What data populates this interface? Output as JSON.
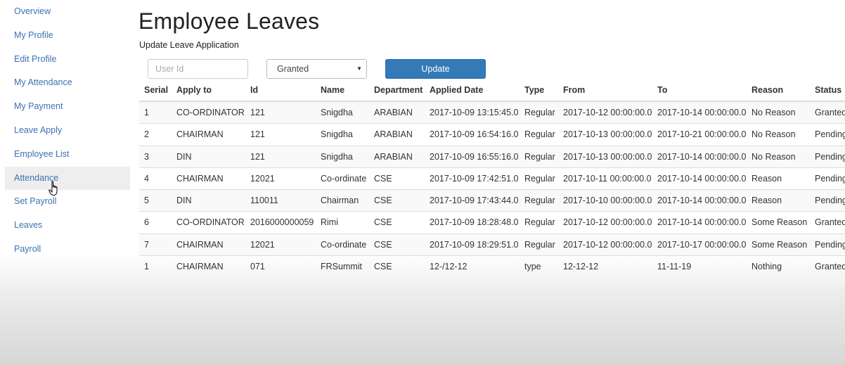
{
  "sidebar": {
    "items": [
      {
        "label": "Overview"
      },
      {
        "label": "My Profile"
      },
      {
        "label": "Edit Profile"
      },
      {
        "label": "My Attendance"
      },
      {
        "label": "My Payment"
      },
      {
        "label": "Leave Apply"
      },
      {
        "label": "Employee List"
      },
      {
        "label": "Attendance",
        "active": true
      },
      {
        "label": "Set Payroll"
      },
      {
        "label": "Leaves"
      },
      {
        "label": "Payroll"
      }
    ]
  },
  "page": {
    "title": "Employee Leaves",
    "subtitle": "Update Leave Application"
  },
  "form": {
    "userid_placeholder": "User Id",
    "status_selected": "Granted",
    "update_label": "Update"
  },
  "table": {
    "headers": [
      "Serial",
      "Apply to",
      "Id",
      "Name",
      "Department",
      "Applied Date",
      "Type",
      "From",
      "To",
      "Reason",
      "Status"
    ],
    "rows": [
      [
        "1",
        "CO-ORDINATOR",
        "121",
        "Snigdha",
        "ARABIAN",
        "2017-10-09 13:15:45.0",
        "Regular",
        "2017-10-12 00:00:00.0",
        "2017-10-14 00:00:00.0",
        "No Reason",
        "Granted"
      ],
      [
        "2",
        "CHAIRMAN",
        "121",
        "Snigdha",
        "ARABIAN",
        "2017-10-09 16:54:16.0",
        "Regular",
        "2017-10-13 00:00:00.0",
        "2017-10-21 00:00:00.0",
        "No Reason",
        "Pending"
      ],
      [
        "3",
        "DIN",
        "121",
        "Snigdha",
        "ARABIAN",
        "2017-10-09 16:55:16.0",
        "Regular",
        "2017-10-13 00:00:00.0",
        "2017-10-14 00:00:00.0",
        "No Reason",
        "Pending"
      ],
      [
        "4",
        "CHAIRMAN",
        "12021",
        "Co-ordinate",
        "CSE",
        "2017-10-09 17:42:51.0",
        "Regular",
        "2017-10-11 00:00:00.0",
        "2017-10-14 00:00:00.0",
        "Reason",
        "Pending"
      ],
      [
        "5",
        "DIN",
        "110011",
        "Chairman",
        "CSE",
        "2017-10-09 17:43:44.0",
        "Regular",
        "2017-10-10 00:00:00.0",
        "2017-10-14 00:00:00.0",
        "Reason",
        "Pending"
      ],
      [
        "6",
        "CO-ORDINATOR",
        "2016000000059",
        "Rimi",
        "CSE",
        "2017-10-09 18:28:48.0",
        "Regular",
        "2017-10-12 00:00:00.0",
        "2017-10-14 00:00:00.0",
        "Some Reason",
        "Granted"
      ],
      [
        "7",
        "CHAIRMAN",
        "12021",
        "Co-ordinate",
        "CSE",
        "2017-10-09 18:29:51.0",
        "Regular",
        "2017-10-12 00:00:00.0",
        "2017-10-17 00:00:00.0",
        "Some Reason",
        "Pending"
      ],
      [
        "1",
        "CHAIRMAN",
        "071",
        "FRSummit",
        "CSE",
        "12-/12-12",
        "type",
        "12-12-12",
        "11-11-19",
        "Nothing",
        "Granted"
      ]
    ]
  },
  "icons": {
    "cursor": "hand-pointer-icon",
    "select_arrow": "caret-down-icon"
  }
}
